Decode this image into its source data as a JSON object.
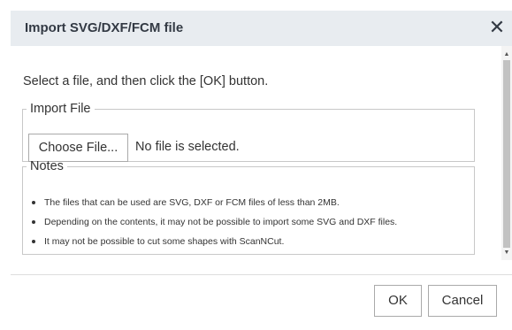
{
  "dialog": {
    "title": "Import SVG/DXF/FCM file",
    "close_glyph": "✕"
  },
  "content": {
    "instruction": "Select a file, and then click the [OK] button.",
    "import_file": {
      "legend": "Import File",
      "choose_button_label": "Choose File...",
      "file_status": "No file is selected."
    },
    "notes": {
      "legend": "Notes",
      "items": [
        "The files that can be used are SVG, DXF or FCM files of less than 2MB.",
        "Depending on the contents, it may not be possible to import some SVG and DXF files.",
        "It may not be possible to cut some shapes with ScanNCut."
      ]
    }
  },
  "footer": {
    "ok_label": "OK",
    "cancel_label": "Cancel"
  },
  "icons": {
    "close": "close-icon",
    "scroll_up": "chevron-up-icon",
    "scroll_down": "chevron-down-icon"
  }
}
